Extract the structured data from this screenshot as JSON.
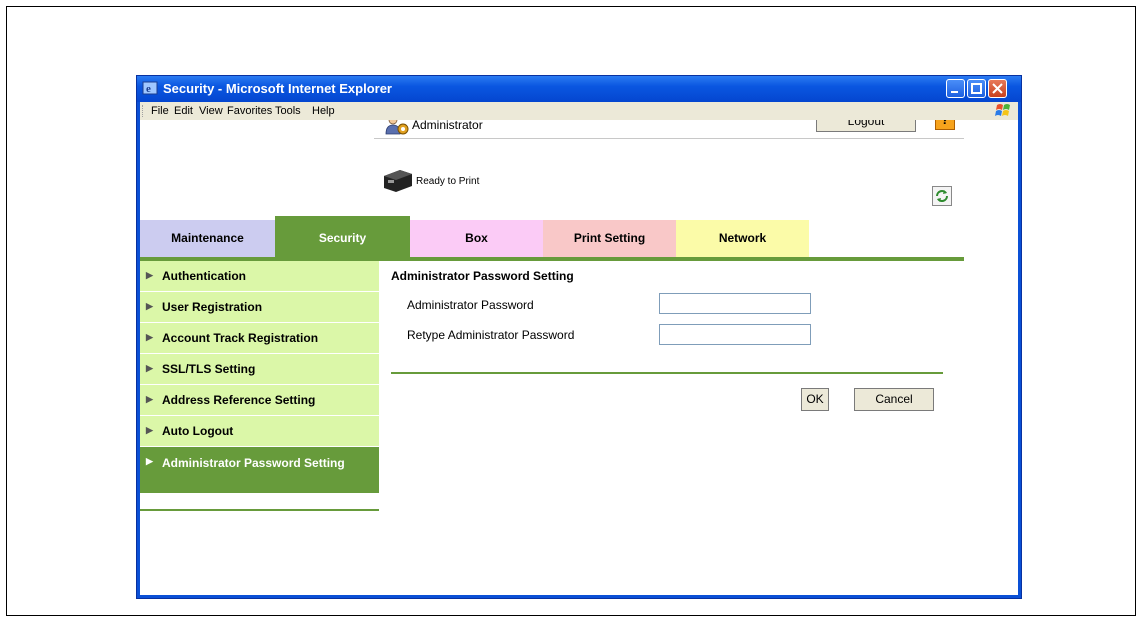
{
  "window": {
    "title": "Security - Microsoft Internet Explorer"
  },
  "menu": [
    "File",
    "Edit",
    "View",
    "Favorites",
    "Tools",
    "Help"
  ],
  "header": {
    "user": "Administrator",
    "logout_label": "Logout",
    "help_label": "?",
    "status": "Ready to Print"
  },
  "tabs": [
    "Maintenance",
    "Security",
    "Box",
    "Print Setting",
    "Network"
  ],
  "sidebar": {
    "items": [
      "Authentication",
      "User Registration",
      "Account Track Registration",
      "SSL/TLS Setting",
      "Address Reference Setting",
      "Auto Logout",
      "Administrator Password Setting"
    ]
  },
  "form": {
    "title": "Administrator Password Setting",
    "password_label": "Administrator Password",
    "retype_label": "Retype Administrator Password",
    "password_value": "",
    "retype_value": "",
    "ok_label": "OK",
    "cancel_label": "Cancel"
  },
  "colors": {
    "accent_green": "#679b3b",
    "sidebar_bg": "#dbf7a8",
    "tab_maintenance": "#ccccf0",
    "tab_box": "#fbcbf6",
    "tab_print": "#f9c8c8",
    "tab_network": "#fbfba8",
    "titlebar_blue": "#0a56e0"
  },
  "icons": {
    "title": "ie-icon",
    "user": "user-icon",
    "status": "printer-icon",
    "refresh": "refresh-icon",
    "brand": "windows-flag-icon"
  }
}
